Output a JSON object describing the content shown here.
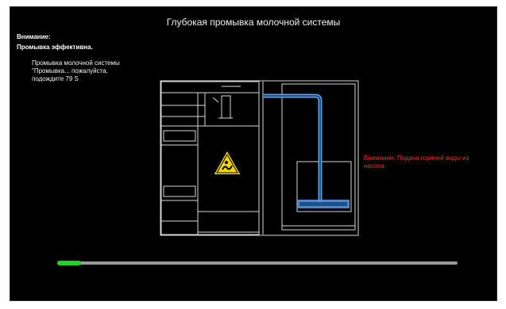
{
  "screen": {
    "title": "Глубокая промывка молочной системы",
    "attention_label": "Внимание:",
    "flushing_label": "Промывка эффективна.",
    "status_message": "Промывка молочной системы\n\"Промывка... пожалуйста,\nподождите 79 S",
    "warning_message": "Внимание: Подача горячей воды из насоса",
    "progress": 0.06,
    "colors": {
      "background": "#000000",
      "warning": "#ff2a2a",
      "progress_fill": "#22d02a",
      "progress_track": "#9a9a9a",
      "tube": "#5aa0e6",
      "hazard": "#f5d400"
    },
    "icons": {
      "hazard": "hot-surface-warning-icon"
    }
  }
}
